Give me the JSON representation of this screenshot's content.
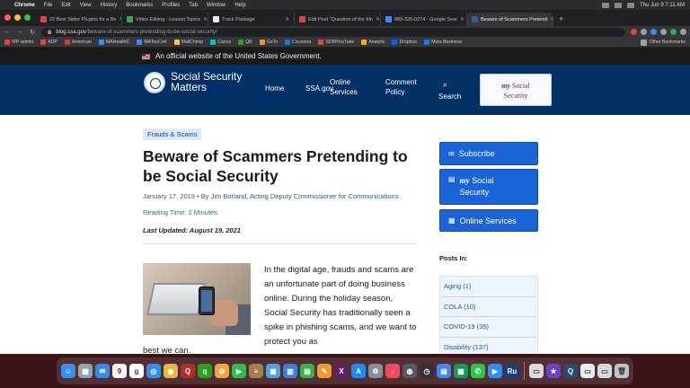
{
  "menubar": {
    "app": "Chrome",
    "items": [
      "File",
      "Edit",
      "View",
      "History",
      "Bookmarks",
      "Profiles",
      "Tab",
      "Window",
      "Help"
    ],
    "clock": "Thu Jun 9  7:11 AM"
  },
  "tabs": [
    {
      "label": "22 Best Slider Plugins for a Be",
      "color": "#e0453a"
    },
    {
      "label": "Video Editing - Lesson Topics",
      "color": "#34a853"
    },
    {
      "label": "Track Package",
      "color": "#e8eaed"
    },
    {
      "label": "Edit Post \"Question of the Mo",
      "color": "#e0453a"
    },
    {
      "label": "888-326-0274 - Google Sear",
      "color": "#4285f4"
    },
    {
      "label": "Beware of Scammers Pretendi",
      "color": "#3b5998"
    }
  ],
  "address_bar": {
    "host": "blog.ssa.gov",
    "path": "/beware-of-scammers-pretending-to-be-social-security/"
  },
  "bookmarks": [
    {
      "label": "WP-admin",
      "color": "#e0453a"
    },
    {
      "label": "ADP",
      "color": "#e0453a"
    },
    {
      "label": "American",
      "color": "#d4363e"
    },
    {
      "label": "MAHealthC",
      "color": "#4285f4"
    },
    {
      "label": "MATeeCmt",
      "color": "#4285f4"
    },
    {
      "label": "MailChimp",
      "color": "#f2c94c"
    },
    {
      "label": "Canva",
      "color": "#00c4cc"
    },
    {
      "label": "QB",
      "color": "#2ca01c"
    },
    {
      "label": "GoTo",
      "color": "#f68d2e"
    },
    {
      "label": "Coursera",
      "color": "#2a73cc"
    },
    {
      "label": "SDMYouTube",
      "color": "#e0453a"
    },
    {
      "label": "Analytic",
      "color": "#f9ab00"
    },
    {
      "label": "Dropbox",
      "color": "#0061ff"
    },
    {
      "label": "Meta Business",
      "color": "#1877f2"
    }
  ],
  "bookmarks_other": "Other Bookmarks",
  "gov_banner": "An official website of the United States Government.",
  "site": {
    "brand_line1": "Social Security",
    "brand_line2": "Matters",
    "nav": {
      "home": "Home",
      "ssa": "SSA.gov",
      "online1": "Online",
      "online2": "Services",
      "comment1": "Comment",
      "comment2": "Policy",
      "search": "Search"
    },
    "mysocial_my": "my",
    "mysocial_line1": "Social",
    "mysocial_line2": "Security"
  },
  "article": {
    "tag": "Frauds & Scams",
    "title": "Beware of Scammers Pretending to be Social Security",
    "date": "January 17, 2019",
    "by": " • By ",
    "author": "Jim Borland, Acting Deputy Commissioner for Communications",
    "reading_time": "Reading Time: 2 Minutes",
    "last_updated": "Last Updated: August 19, 2021",
    "body": "In the digital age, frauds and scams are an unfortunate part of doing business online. During the holiday season, Social Security has traditionally seen a spike in phishing scams, and we want to protect you as",
    "body_cont": "best we can."
  },
  "sidebar": {
    "subscribe": "Subscribe",
    "my": "my",
    "mysocial1": "Social",
    "mysocial2": "Security",
    "online_services": "Online Services",
    "posts_in": "Posts In:",
    "categories": [
      "Aging (1)",
      "COLA (10)",
      "COVID-19 (35)",
      "Disability (137)"
    ]
  },
  "dock_apps": [
    {
      "name": "finder",
      "color": "#3d8cf0",
      "glyph": "☺"
    },
    {
      "name": "launchpad",
      "color": "#9aa3ad",
      "glyph": "▦"
    },
    {
      "name": "mail",
      "color": "#3a86f2",
      "glyph": "✉"
    },
    {
      "name": "calendar",
      "color": "#f4f4f4",
      "glyph": "9"
    },
    {
      "name": "google",
      "color": "#ffffff",
      "glyph": "g"
    },
    {
      "name": "safari",
      "color": "#2f8ef0",
      "glyph": "◎"
    },
    {
      "name": "chrome",
      "color": "#e9b640",
      "glyph": "◉"
    },
    {
      "name": "quora",
      "color": "#b92b27",
      "glyph": "Q"
    },
    {
      "name": "quickbooks",
      "color": "#2ca01c",
      "glyph": "q"
    },
    {
      "name": "photos",
      "color": "#f3a43b",
      "glyph": "✿"
    },
    {
      "name": "facetime",
      "color": "#2fbf4a",
      "glyph": "▶"
    },
    {
      "name": "notes",
      "color": "#a27f4b",
      "glyph": "≡"
    },
    {
      "name": "preview",
      "color": "#4aa3e0",
      "glyph": "▣"
    },
    {
      "name": "keynote",
      "color": "#3d7ee0",
      "glyph": "▥"
    },
    {
      "name": "numbers",
      "color": "#35b34a",
      "glyph": "▤"
    },
    {
      "name": "pages",
      "color": "#f39a2b",
      "glyph": "✎"
    },
    {
      "name": "slack",
      "color": "#611f69",
      "glyph": "X"
    },
    {
      "name": "appstore",
      "color": "#1d8cf2",
      "glyph": "A"
    },
    {
      "name": "settings",
      "color": "#8a8d93",
      "glyph": "⚙"
    },
    {
      "name": "music",
      "color": "#f24a5c",
      "glyph": "♪"
    },
    {
      "name": "screenshot",
      "color": "#555a62",
      "glyph": "◍"
    },
    {
      "name": "clock",
      "color": "#333333",
      "glyph": "◷"
    },
    {
      "name": "docs",
      "color": "#4285f4",
      "glyph": "▤"
    },
    {
      "name": "sheets",
      "color": "#0f9d58",
      "glyph": "▦"
    },
    {
      "name": "messages",
      "color": "#30c34b",
      "glyph": "✆"
    },
    {
      "name": "zoom",
      "color": "#2d8cff",
      "glyph": "▶"
    },
    {
      "name": "ru",
      "color": "#1c3f7a",
      "glyph": "Ru"
    },
    {
      "name": "printer",
      "color": "#dcdcdc",
      "glyph": "▭"
    },
    {
      "name": "imovie",
      "color": "#6b43c9",
      "glyph": "★"
    },
    {
      "name": "quicktime",
      "color": "#2b4a73",
      "glyph": "Q"
    },
    {
      "name": "finder-doc",
      "color": "#ececec",
      "glyph": "▭"
    },
    {
      "name": "folder",
      "color": "#d9d9d9",
      "glyph": "▭"
    },
    {
      "name": "trash",
      "color": "#bfc3c8",
      "glyph": "🗑"
    }
  ]
}
